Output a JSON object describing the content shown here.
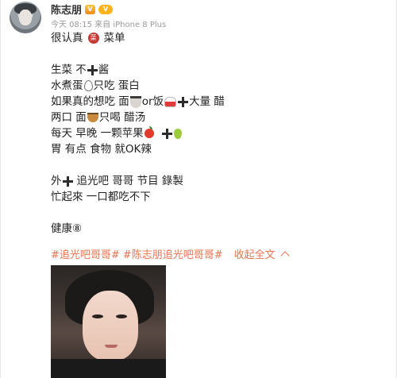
{
  "header": {
    "username": "陈志朋",
    "meta": "今天 08:15 来自 iPhone 8 Plus"
  },
  "badges": {
    "vip_text": "V",
    "vip2_text": "V"
  },
  "content": {
    "line1_a": "很认真",
    "line1_badge": "菜",
    "line1_b": "菜单",
    "line2_a": "生菜 不",
    "line2_b": "酱",
    "line3_a": "水煮蛋",
    "line3_b": "只吃 蛋白",
    "line4_a": "如果真的想吃 面",
    "line4_b": "or饭",
    "line4_c": "大量 醋",
    "line5_a": "两口 面",
    "line5_b": "只喝 醋汤",
    "line6_a": "每天 早晚 一颗苹果",
    "line7": "胃 有点 食物 就OK辣",
    "line8_a": "外",
    "line8_b": "追光吧 哥哥 节目 錄製",
    "line9": "忙起來 一口都吃不下",
    "line10": "健康⑧"
  },
  "hashtags": {
    "tag1": "#追光吧哥哥#",
    "tag2": "#陈志朋追光吧哥哥#",
    "collapse": "收起全文"
  },
  "icons": {
    "cross": "plus-cross-icon",
    "egg": "egg-icon",
    "noodle": "noodle-icon",
    "rice": "rice-icon",
    "apple": "apple-icon",
    "pear": "pear-icon",
    "bowl": "bowl-icon"
  },
  "colors": {
    "hashtag": "#eb7350",
    "meta": "#999999"
  }
}
